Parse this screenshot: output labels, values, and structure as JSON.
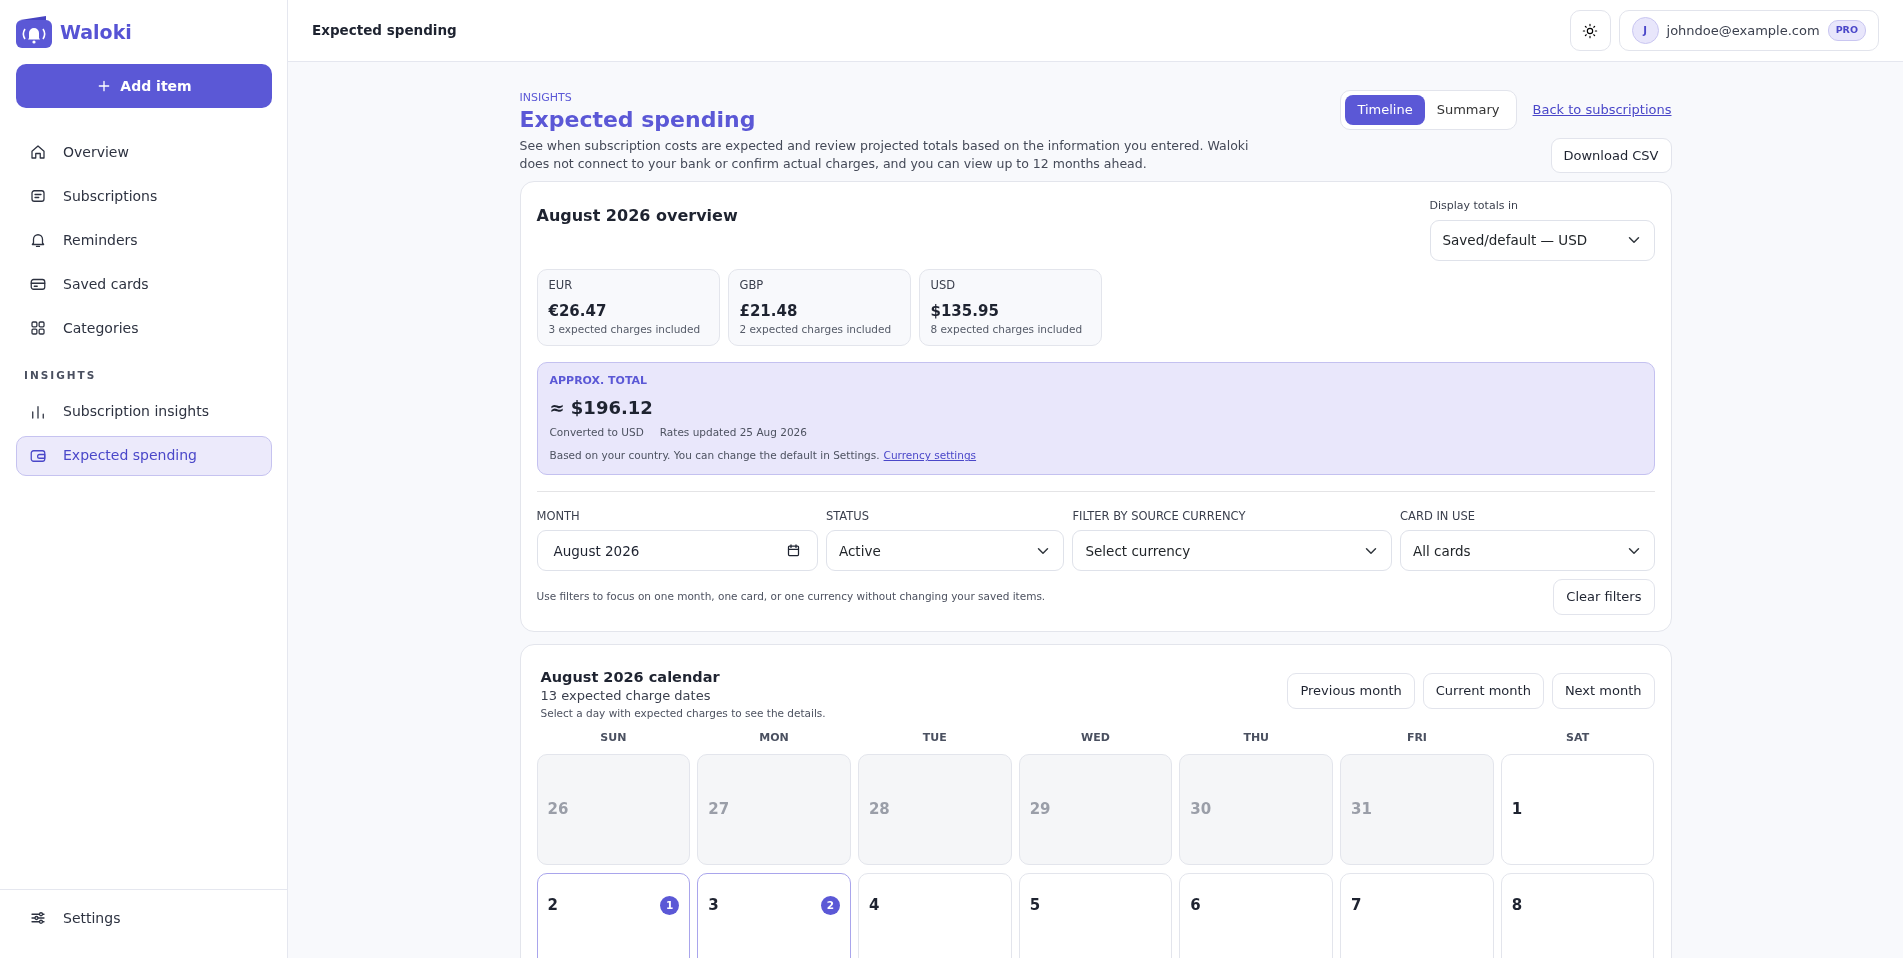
{
  "sidebar": {
    "brand": "Waloki",
    "add_button": "Add item",
    "items": [
      {
        "label": "Overview",
        "selected": false
      },
      {
        "label": "Subscriptions",
        "selected": false
      },
      {
        "label": "Reminders",
        "selected": false
      },
      {
        "label": "Saved cards",
        "selected": false
      },
      {
        "label": "Categories",
        "selected": false
      }
    ],
    "section": {
      "heading": "INSIGHTS",
      "items": [
        {
          "label": "Subscription insights",
          "selected": false
        },
        {
          "label": "Expected spending",
          "selected": true
        }
      ]
    },
    "footer_item": "Settings"
  },
  "topbar": {
    "title": "Expected spending",
    "user": {
      "initial": "J",
      "email": "johndoe@example.com",
      "badge": "PRO"
    }
  },
  "header": {
    "eyebrow": "INSIGHTS",
    "title": "Expected spending",
    "description": "See when subscription costs are expected and review projected totals based on the information you entered. Waloki does not connect to your bank or confirm actual charges, and you can view up to 12 months ahead.",
    "tabs": [
      {
        "label": "Timeline",
        "selected": true
      },
      {
        "label": "Summary",
        "selected": false
      }
    ],
    "back_link": "Back to subscriptions",
    "download_button": "Download CSV"
  },
  "overview": {
    "title": "August 2026 overview",
    "display_label": "Display totals in",
    "display_value": "Saved/default — USD",
    "currencies": [
      {
        "code": "EUR",
        "amount": "€26.47",
        "note": "3 expected charges included"
      },
      {
        "code": "GBP",
        "amount": "£21.48",
        "note": "2 expected charges included"
      },
      {
        "code": "USD",
        "amount": "$135.95",
        "note": "8 expected charges included"
      }
    ],
    "approx": {
      "label": "APPROX. TOTAL",
      "amount": "≈ $196.12",
      "converted": "Converted to USD",
      "rates": "Rates updated 25 Aug 2026",
      "note": "Based on your country. You can change the default in Settings.",
      "link": "Currency settings"
    },
    "filters": [
      {
        "label": "MONTH",
        "kind": "date",
        "value": "August 2026"
      },
      {
        "label": "STATUS",
        "kind": "select",
        "value": "Active"
      },
      {
        "label": "FILTER BY SOURCE CURRENCY",
        "kind": "select",
        "value": "Select currency"
      },
      {
        "label": "CARD IN USE",
        "kind": "select",
        "value": "All cards"
      }
    ],
    "filter_hint": "Use filters to focus on one month, one card, or one currency without changing your saved items.",
    "clear_button": "Clear filters"
  },
  "calendar": {
    "title": "August 2026 calendar",
    "subtitle": "13 expected charge dates",
    "hint": "Select a day with expected charges to see the details.",
    "nav_buttons": [
      "Previous month",
      "Current month",
      "Next month"
    ],
    "weekdays": [
      "SUN",
      "MON",
      "TUE",
      "WED",
      "THU",
      "FRI",
      "SAT"
    ],
    "weeks": [
      [
        {
          "day": "26",
          "in_month": false
        },
        {
          "day": "27",
          "in_month": false
        },
        {
          "day": "28",
          "in_month": false
        },
        {
          "day": "29",
          "in_month": false
        },
        {
          "day": "30",
          "in_month": false
        },
        {
          "day": "31",
          "in_month": false
        },
        {
          "day": "1",
          "in_month": true
        }
      ],
      [
        {
          "day": "2",
          "in_month": true,
          "count": "1"
        },
        {
          "day": "3",
          "in_month": true,
          "count": "2"
        },
        {
          "day": "4",
          "in_month": true
        },
        {
          "day": "5",
          "in_month": true
        },
        {
          "day": "6",
          "in_month": true
        },
        {
          "day": "7",
          "in_month": true
        },
        {
          "day": "8",
          "in_month": true
        }
      ]
    ]
  }
}
